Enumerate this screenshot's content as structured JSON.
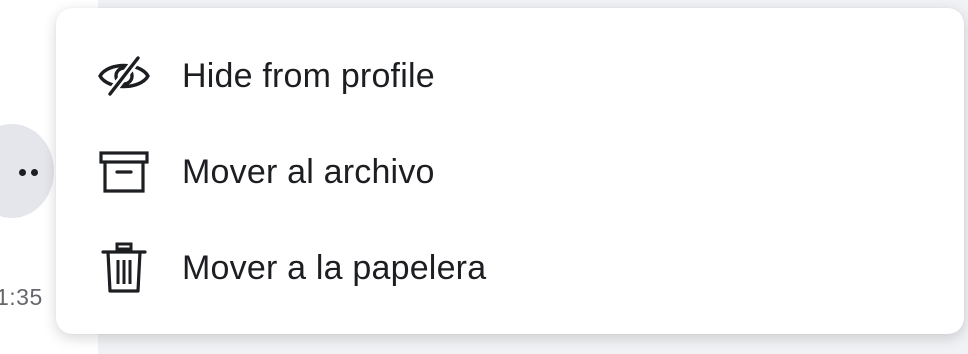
{
  "background": {
    "timestamp": "1:35"
  },
  "menu": {
    "items": [
      {
        "label": "Hide from profile",
        "icon": "eye-slash-icon"
      },
      {
        "label": "Mover al archivo",
        "icon": "archive-box-icon"
      },
      {
        "label": "Mover a la papelera",
        "icon": "trash-icon"
      }
    ]
  },
  "colors": {
    "text": "#1c1e21",
    "secondary_text": "#65676b",
    "button_bg": "#e4e6eb"
  }
}
